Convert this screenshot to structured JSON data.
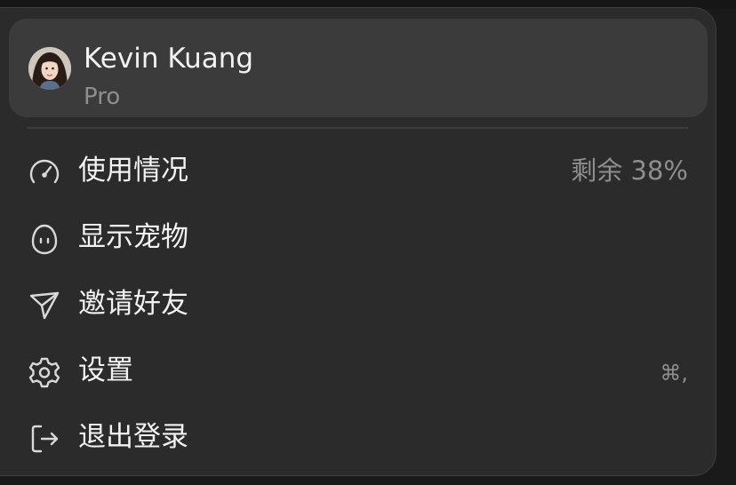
{
  "profile": {
    "name": "Kevin Kuang",
    "plan": "Pro",
    "avatar_icon": "user-avatar-photo"
  },
  "menu": {
    "items": [
      {
        "label": "使用情况",
        "icon": "gauge-icon",
        "trail": "剩余 38%"
      },
      {
        "label": "显示宠物",
        "icon": "egg-face-icon",
        "trail": ""
      },
      {
        "label": "邀请好友",
        "icon": "send-icon",
        "trail": ""
      },
      {
        "label": "设置",
        "icon": "gear-icon",
        "trail": "⌘,"
      },
      {
        "label": "退出登录",
        "icon": "logout-icon",
        "trail": ""
      }
    ]
  },
  "colors": {
    "menu_bg": "#2b2b2b",
    "card_bg": "#3b3b3b",
    "text_primary": "#f2f2f2",
    "text_secondary": "#8e8e8e"
  }
}
